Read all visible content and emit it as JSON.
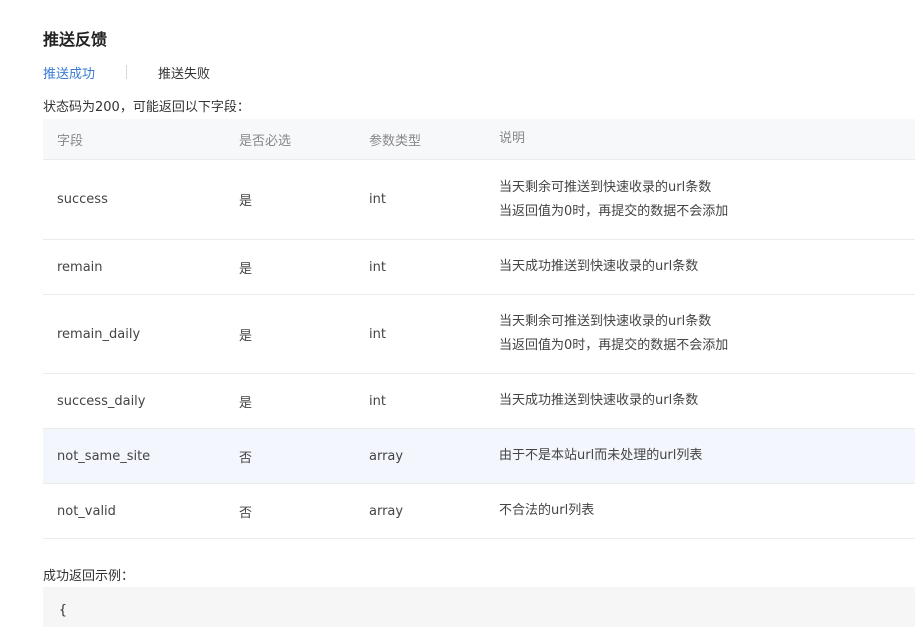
{
  "title": "推送反馈",
  "tabs": [
    {
      "label": "推送成功",
      "active": true
    },
    {
      "label": "推送失败",
      "active": false
    }
  ],
  "intro": "状态码为200，可能返回以下字段：",
  "table": {
    "headers": [
      "字段",
      "是否必选",
      "参数类型",
      "说明"
    ],
    "rows": [
      {
        "field": "success",
        "required": "是",
        "type": "int",
        "desc1": "当天剩余可推送到快速收录的url条数",
        "desc2": "当返回值为0时，再提交的数据不会添加"
      },
      {
        "field": "remain",
        "required": "是",
        "type": "int",
        "desc1": "当天成功推送到快速收录的url条数",
        "desc2": ""
      },
      {
        "field": "remain_daily",
        "required": "是",
        "type": "int",
        "desc1": "当天剩余可推送到快速收录的url条数",
        "desc2": "当返回值为0时，再提交的数据不会添加"
      },
      {
        "field": "success_daily",
        "required": "是",
        "type": "int",
        "desc1": "当天成功推送到快速收录的url条数",
        "desc2": ""
      },
      {
        "field": "not_same_site",
        "required": "否",
        "type": "array",
        "desc1": "由于不是本站url而未处理的url列表",
        "desc2": ""
      },
      {
        "field": "not_valid",
        "required": "否",
        "type": "array",
        "desc1": "不合法的url列表",
        "desc2": ""
      }
    ]
  },
  "example_label": "成功返回示例：",
  "code_first_line": "{"
}
